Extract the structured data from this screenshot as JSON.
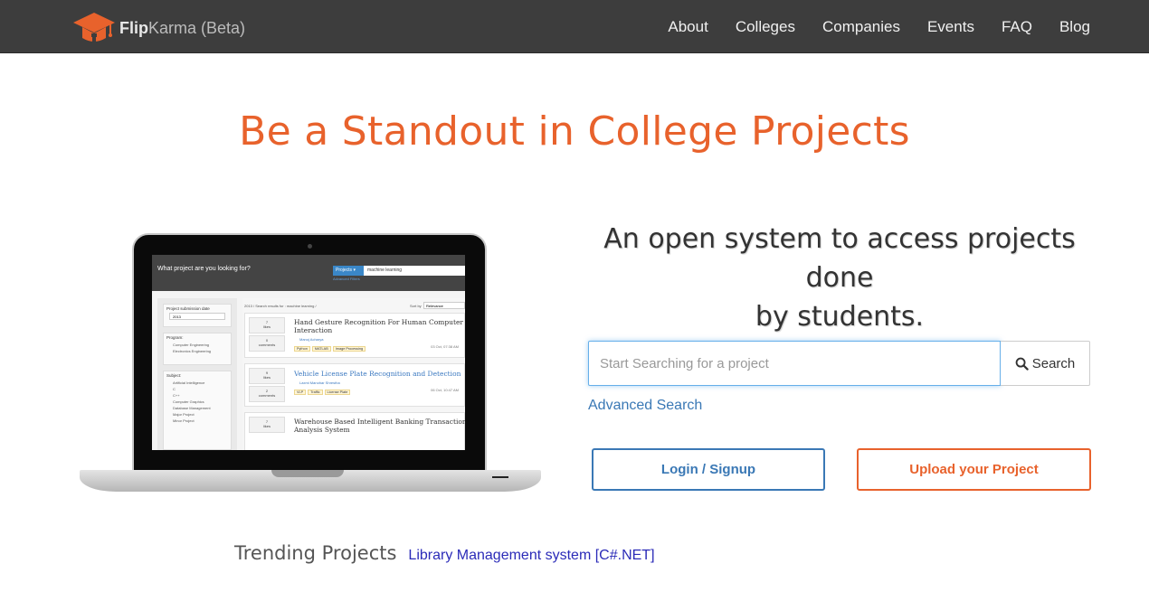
{
  "nav": {
    "brand_bold": "Flip",
    "brand_rest": "Karma (Beta)",
    "links": [
      "About",
      "Colleges",
      "Companies",
      "Events",
      "FAQ",
      "Blog"
    ]
  },
  "hero": {
    "title": "Be a Standout in College Projects",
    "tagline_line1": "An open system to access projects done",
    "tagline_line2": "by students."
  },
  "search": {
    "placeholder": "Start Searching for a project",
    "button_label": "Search",
    "advanced_label": "Advanced Search"
  },
  "actions": {
    "login_label": "Login / Signup",
    "upload_label": "Upload your Project"
  },
  "trending": {
    "label": "Trending Projects",
    "link": "Library Management system [C#.NET]"
  },
  "screen": {
    "question": "What project are you looking for?",
    "projects_btn": "Projects ▾",
    "search_term": "machine learning",
    "advanced": "Advanced Filters",
    "filter_date_label": "Project submission date",
    "filter_date_value": "2013",
    "program_label": "Program:",
    "programs": [
      "Computer Engineering",
      "Electronics Engineering"
    ],
    "subject_label": "Subject:",
    "subjects": [
      "Artificial Intelligence",
      "C",
      "C++",
      "Computer Graphics",
      "Database Management",
      "Major Project",
      "Minor Project"
    ],
    "crumb": "2013 / Search results for : machine learning /",
    "sort_label": "Sort by",
    "sort_value": "Relevance",
    "results": [
      {
        "likes": "7",
        "comments": "0",
        "title1": "Hand Gesture Recognition For Human Computer",
        "title2": "Interaction",
        "author": "Manoj Acharya",
        "tags": [
          "Python",
          "MATLAB",
          "Image Processing"
        ],
        "date": "03 Oct, 07:38 AM"
      },
      {
        "likes": "9",
        "comments": "2",
        "title1": "Vehicle License Plate Recognition and Detection",
        "title2": "",
        "author": "Laxmi Manohar Shrestha",
        "tags": [
          "VLP",
          "Traffic",
          "License Plate"
        ],
        "date": "06 Oct, 10:47 AM"
      },
      {
        "likes": "7",
        "comments": "",
        "title1": "Warehouse Based Intelligent Banking Transaction",
        "title2": "Analysis System",
        "author": "",
        "tags": [],
        "date": ""
      }
    ],
    "likes_word": "likes",
    "comments_word": "comments"
  }
}
